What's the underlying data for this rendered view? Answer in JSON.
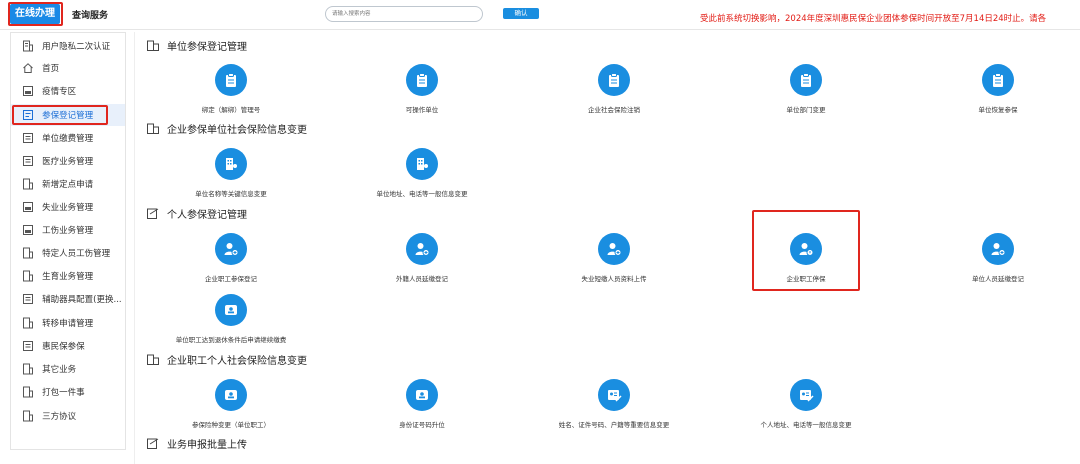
{
  "header": {
    "tab_online": "在线办理",
    "tab_query": "查询服务",
    "search_placeholder": "请输入搜索内容",
    "confirm_label": "确认",
    "notice": "受此前系统切换影响，2024年度深圳惠民保企业团体参保时间开放至7月14日24时止。请各"
  },
  "sidebar": {
    "items": [
      {
        "label": "用户隐私二次认证",
        "icon": "building-icon"
      },
      {
        "label": "首页",
        "icon": "home-icon"
      },
      {
        "label": "疫情专区",
        "icon": "card-icon"
      },
      {
        "label": "参保登记管理",
        "icon": "register-icon"
      },
      {
        "label": "单位缴费管理",
        "icon": "form-icon"
      },
      {
        "label": "医疗业务管理",
        "icon": "form-icon"
      },
      {
        "label": "新增定点申请",
        "icon": "building-icon"
      },
      {
        "label": "失业业务管理",
        "icon": "card-icon"
      },
      {
        "label": "工伤业务管理",
        "icon": "card-icon"
      },
      {
        "label": "特定人员工伤管理",
        "icon": "building-icon"
      },
      {
        "label": "生育业务管理",
        "icon": "building-icon"
      },
      {
        "label": "辅助器具配置(更换...",
        "icon": "form-icon"
      },
      {
        "label": "转移申请管理",
        "icon": "building-icon"
      },
      {
        "label": "惠民保参保",
        "icon": "form-icon"
      },
      {
        "label": "其它业务",
        "icon": "building-icon"
      },
      {
        "label": "打包一件事",
        "icon": "building-icon"
      },
      {
        "label": "三方协议",
        "icon": "building-icon"
      }
    ]
  },
  "sections": [
    {
      "title": "单位参保登记管理",
      "items": [
        "绑定（解绑）管理号",
        "可操作单位",
        "企业社会保险注销",
        "单位部门变更",
        "单位恢复参保"
      ]
    },
    {
      "title": "企业参保单位社会保险信息变更",
      "items": [
        "单位名称等关键信息变更",
        "单位地址、电话等一般信息变更"
      ]
    },
    {
      "title": "个人参保登记管理",
      "items": [
        "企业职工参保登记",
        "外籍人员延缴登记",
        "失业短缴人员资料上传",
        "企业职工停保",
        "单位人员延缴登记",
        "单位职工达到退休条件后申请继续缴费"
      ]
    },
    {
      "title": "企业职工个人社会保险信息变更",
      "items": [
        "参保险种变更（单位职工）",
        "身份证号码升位",
        "姓名、证件号码、户籍等重要信息变更",
        "个人地址、电话等一般信息变更"
      ]
    },
    {
      "title": "业务申报批量上传",
      "items": []
    }
  ],
  "colors": {
    "accent": "#1a8ee0",
    "highlight": "#e0261e",
    "notice": "#e21b14"
  }
}
